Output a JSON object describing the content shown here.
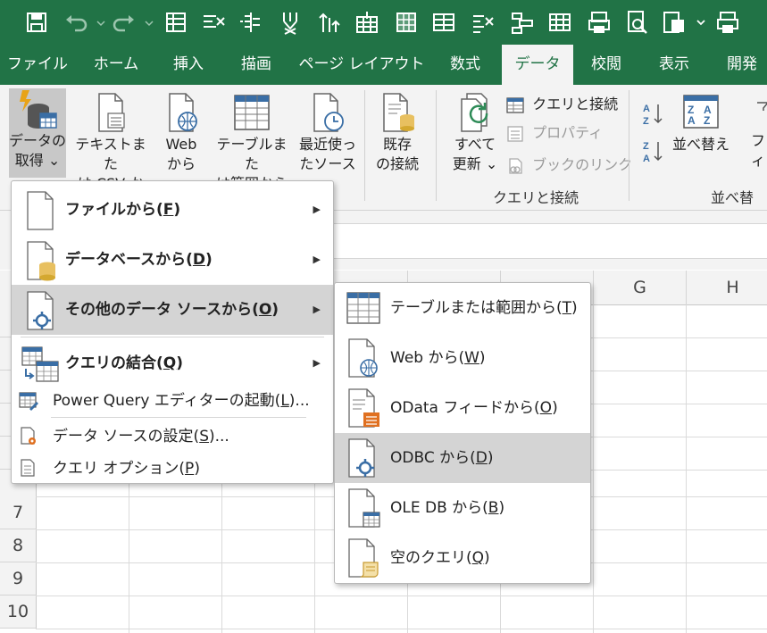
{
  "qat": {
    "icons": [
      "save-icon",
      "undo-icon",
      "redo-icon",
      "form-icon",
      "clear-filter-icon",
      "text-to-columns-icon",
      "remove-filter-icon",
      "sort-filter-icon",
      "insert-table-icon",
      "grid-icon",
      "table-icon",
      "delete-column-icon",
      "outline-icon",
      "table2-icon",
      "print-preview-icon",
      "find-icon",
      "page-setup-icon",
      "customize-icon",
      "print-icon"
    ]
  },
  "tabs": [
    {
      "label": "ファイル"
    },
    {
      "label": "ホーム"
    },
    {
      "label": "挿入"
    },
    {
      "label": "描画"
    },
    {
      "label": "ページ レイアウト"
    },
    {
      "label": "数式"
    },
    {
      "label": "データ"
    },
    {
      "label": "校閲"
    },
    {
      "label": "表示"
    },
    {
      "label": "開発"
    }
  ],
  "ribbon": {
    "get_data": "データの\n取得 ⌄",
    "from_text_csv": "テキストまた\nは CSV から",
    "from_web": "Web\nから",
    "from_table": "テーブルまた\nは範囲から",
    "recent_sources": "最近使っ\nたソース",
    "existing_connections": "既存\nの接続",
    "refresh_all": "すべて\n更新 ⌄",
    "queries_connections": "クエリと接続",
    "properties": "プロパティ",
    "edit_links": "ブックのリンク",
    "group_queries": "クエリと接続",
    "sort_label": "並べ替え",
    "filter_label": "フィ",
    "group_sort": "並べ替え"
  },
  "columns": [
    "G",
    "H"
  ],
  "rows": [
    "7",
    "8",
    "9",
    "10"
  ],
  "menu": {
    "from_file": {
      "pre": "ファイルから(",
      "key": "F",
      "post": ")"
    },
    "from_database": {
      "pre": "データベースから(",
      "key": "D",
      "post": ")"
    },
    "from_other": {
      "pre": "その他のデータ ソースから(",
      "key": "O",
      "post": ")"
    },
    "combine_queries": {
      "pre": "クエリの結合(",
      "key": "Q",
      "post": ")"
    },
    "launch_pq": {
      "pre": "Power Query エディターの起動(",
      "key": "L",
      "post": ")..."
    },
    "data_source_settings": {
      "pre": "データ ソースの設定(",
      "key": "S",
      "post": ")..."
    },
    "query_options": {
      "pre": "クエリ オプション(",
      "key": "P",
      "post": ")"
    }
  },
  "submenu": {
    "from_table": {
      "pre": "テーブルまたは範囲から(",
      "key": "T",
      "post": ")"
    },
    "from_web": {
      "pre": "Web から(",
      "key": "W",
      "post": ")"
    },
    "from_odata": {
      "pre": "OData フィードから(",
      "key": "O",
      "post": ")"
    },
    "from_odbc": {
      "pre": "ODBC から(",
      "key": "D",
      "post": ")"
    },
    "from_oledb": {
      "pre": "OLE DB から(",
      "key": "B",
      "post": ")"
    },
    "blank_query": {
      "pre": "空のクエリ(",
      "key": "Q",
      "post": ")"
    }
  },
  "colors": {
    "excel_green": "#217346",
    "ribbon_bg": "#f3f3f3",
    "highlight": "#d4d4d4"
  }
}
